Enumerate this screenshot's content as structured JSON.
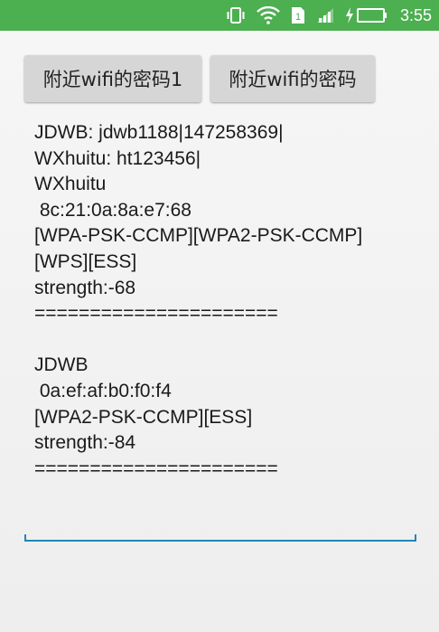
{
  "status_bar": {
    "time": "3:55",
    "colors": {
      "background": "#4caf50",
      "foreground": "#ffffff"
    },
    "icons": [
      "vibrate-icon",
      "wifi-icon",
      "sim-1-icon",
      "signal-icon",
      "charging-bolt-icon",
      "battery-icon"
    ]
  },
  "buttons": {
    "nearby_wifi_passwords_1": "附近wifi的密码1",
    "nearby_wifi_passwords": "附近wifi的密码"
  },
  "output_lines": [
    "JDWB: jdwb1188|147258369|",
    "WXhuitu: ht123456|",
    "WXhuitu",
    " 8c:21:0a:8a:e7:68",
    "[WPA-PSK-CCMP][WPA2-PSK-CCMP]",
    "[WPS][ESS]",
    "strength:-68",
    "======================",
    "",
    "JDWB",
    " 0a:ef:af:b0:f0:f4",
    "[WPA2-PSK-CCMP][ESS]",
    "strength:-84",
    "======================"
  ],
  "edit_text": {
    "value": "",
    "accent_color": "#1e88b5"
  }
}
